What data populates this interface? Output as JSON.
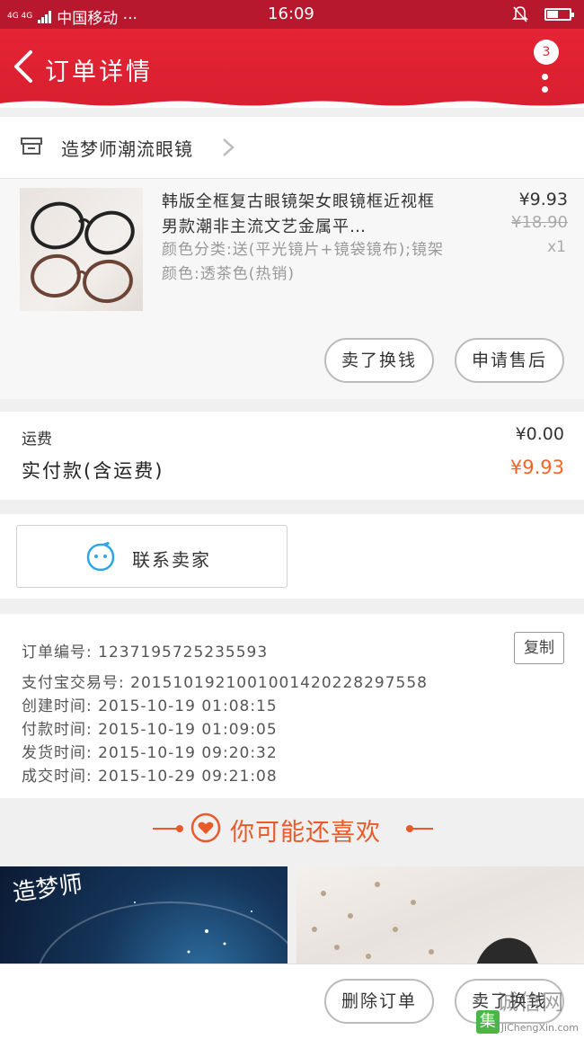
{
  "status_bar": {
    "network": "4G 4G",
    "carrier": "中国移动 ···",
    "time": "16:09",
    "battery_level": 0.5
  },
  "header": {
    "title": "订单详情",
    "badge_count": "3"
  },
  "shop": {
    "name": "造梦师潮流眼镜"
  },
  "product": {
    "title": "韩版全框复古眼镜架女眼镜框近视框男款潮非主流文艺金属平…",
    "spec": "颜色分类:送(平光镜片+镜袋镜布);镜架颜色:透茶色(热销)",
    "price": "¥9.93",
    "old_price": "¥18.90",
    "quantity": "x1",
    "actions": [
      "卖了换钱",
      "申请售后"
    ]
  },
  "totals": {
    "shipping_label": "运费",
    "shipping_value": "¥0.00",
    "paid_label": "实付款(含运费)",
    "paid_value": "¥9.93"
  },
  "contact": {
    "label": "联系卖家"
  },
  "order_info": {
    "order_no": "订单编号: 1237195725235593",
    "alipay_no": "支付宝交易号: 2015101921001001420228297558",
    "created": "创建时间: 2015-10-19 01:08:15",
    "paid": "付款时间: 2015-10-19 01:09:05",
    "shipped": "发货时间: 2015-10-19 09:20:32",
    "completed": "成交时间: 2015-10-29 09:21:08",
    "copy_label": "复制"
  },
  "recommend": {
    "title": "你可能还喜欢",
    "card1_text": "造梦师"
  },
  "bottom": {
    "delete_label": "删除订单",
    "sell_label": "卖了换钱"
  },
  "watermark": {
    "logo_char": "集",
    "text_cn": "诚信网",
    "text_en": "JiChengXin.com"
  },
  "colors": {
    "header_red": "#e52434",
    "accent_orange": "#f0652a",
    "contact_blue": "#2fa6e8"
  }
}
